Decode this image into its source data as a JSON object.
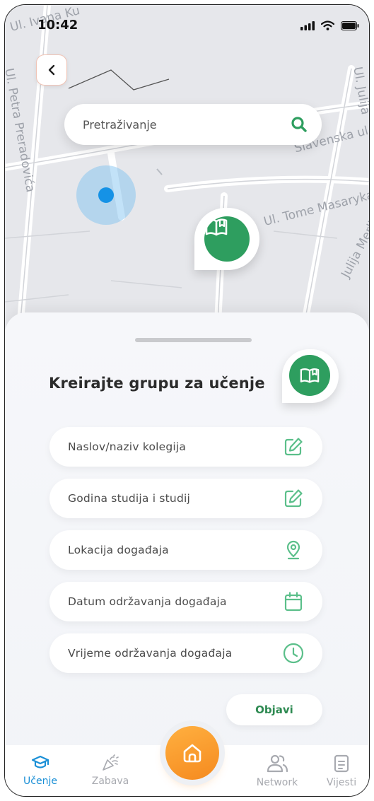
{
  "status_bar": {
    "time": "10:42"
  },
  "map": {
    "streets": [
      {
        "label": "Ul. Ivana Ku"
      },
      {
        "label": "Ul. Petra Preradovića"
      },
      {
        "label": "Slavenska ul."
      },
      {
        "label": "Ul. Tome Masaryka"
      },
      {
        "label": "Julija Merlića"
      },
      {
        "label": "Ul. Julija"
      }
    ]
  },
  "search": {
    "placeholder": "Pretraživanje"
  },
  "sheet": {
    "title": "Kreirajte grupu za učenje",
    "fields": [
      {
        "label": "Naslov/naziv kolegija",
        "icon": "edit-icon"
      },
      {
        "label": "Godina studija i studij",
        "icon": "edit-icon"
      },
      {
        "label": "Lokacija događaja",
        "icon": "location-pin-icon"
      },
      {
        "label": "Datum održavanja događaja",
        "icon": "calendar-icon"
      },
      {
        "label": "Vrijeme održavanja događaja",
        "icon": "clock-icon"
      }
    ],
    "publish_label": "Objavi"
  },
  "nav": {
    "items": [
      {
        "label": "Učenje",
        "icon": "graduation-cap-icon",
        "active": true
      },
      {
        "label": "Zabava",
        "icon": "party-popper-icon",
        "active": false
      },
      {
        "label": "Network",
        "icon": "users-icon",
        "active": false
      },
      {
        "label": "Vijesti",
        "icon": "news-icon",
        "active": false
      }
    ],
    "home_icon": "home-icon"
  },
  "colors": {
    "accent_green": "#2e9e5f",
    "icon_green": "#5bbf8a",
    "active_blue": "#1a8fd6",
    "home_orange": "#f58a1f",
    "location_blue": "#1592e6"
  }
}
